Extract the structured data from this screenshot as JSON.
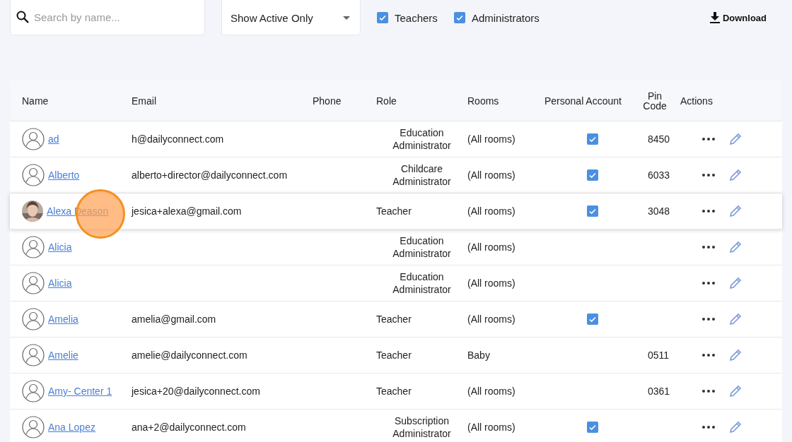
{
  "toolbar": {
    "search": {
      "placeholder": "Search by name..."
    },
    "filter": {
      "value": "Show Active Only"
    },
    "checkboxes": [
      {
        "label": "Teachers",
        "checked": true
      },
      {
        "label": "Administrators",
        "checked": true
      }
    ],
    "download": "Download"
  },
  "table": {
    "columns": [
      "Name",
      "Email",
      "Phone",
      "Role",
      "Rooms",
      "Personal Account",
      "Pin Code",
      "Actions"
    ],
    "rows": [
      {
        "name": "ad",
        "photo": false,
        "email": "h@dailyconnect.com",
        "role": "Education Administrator",
        "rooms": "(All rooms)",
        "personal_account": true,
        "pin": "8450",
        "selected": false,
        "clicked": false
      },
      {
        "name": "Alberto",
        "photo": false,
        "email": "alberto+director@dailyconnect.com",
        "role": "Childcare Administrator",
        "rooms": "(All rooms)",
        "personal_account": true,
        "pin": "6033",
        "selected": false,
        "clicked": false
      },
      {
        "name": "Alexa Deason",
        "photo": true,
        "email": "jesica+alexa@gmail.com",
        "role": "Teacher",
        "rooms": "(All rooms)",
        "personal_account": true,
        "pin": "3048",
        "selected": true,
        "clicked": true
      },
      {
        "name": "Alicia",
        "photo": false,
        "role": "Education Administrator",
        "rooms": "(All rooms)",
        "personal_account": false,
        "selected": false,
        "clicked": false
      },
      {
        "name": "Alicia",
        "photo": false,
        "role": "Education Administrator",
        "rooms": "(All rooms)",
        "personal_account": false,
        "selected": false,
        "clicked": false
      },
      {
        "name": "Amelia",
        "photo": false,
        "email": "amelia@gmail.com",
        "role": "Teacher",
        "rooms": "(All rooms)",
        "personal_account": true,
        "selected": false,
        "clicked": false
      },
      {
        "name": "Amelie",
        "photo": false,
        "email": "amelie@dailyconnect.com",
        "role": "Teacher",
        "rooms": "Baby",
        "personal_account": false,
        "pin": "0511",
        "selected": false,
        "clicked": false
      },
      {
        "name": "Amy- Center 1",
        "photo": false,
        "email": "jesica+20@dailyconnect.com",
        "role": "Teacher",
        "rooms": "(All rooms)",
        "personal_account": false,
        "pin": "0361",
        "selected": false,
        "clicked": false
      },
      {
        "name": "Ana Lopez",
        "photo": false,
        "email": "ana+2@dailyconnect.com",
        "role": "Subscription Administrator",
        "rooms": "(All rooms)",
        "personal_account": true,
        "selected": false,
        "clicked": false
      }
    ]
  }
}
